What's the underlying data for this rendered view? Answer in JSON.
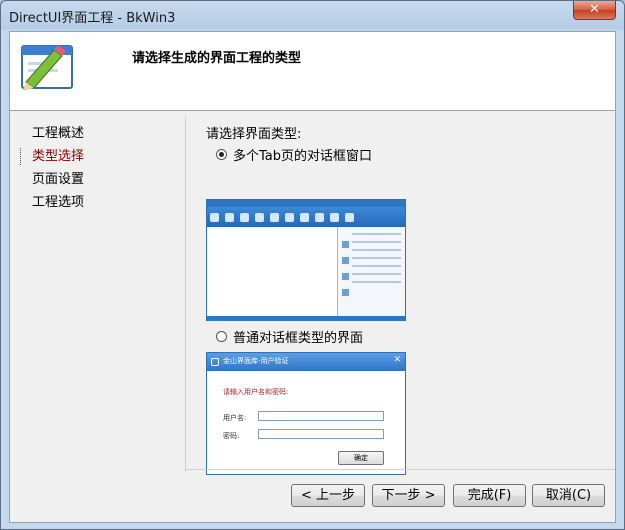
{
  "window": {
    "title": "DirectUI界面工程 - BkWin3",
    "close_label": "✕"
  },
  "header": {
    "title": "请选择生成的界面工程的类型"
  },
  "nav": {
    "items": [
      {
        "label": "工程概述"
      },
      {
        "label": "类型选择",
        "active": true
      },
      {
        "label": "页面设置"
      },
      {
        "label": "工程选项"
      }
    ]
  },
  "panel": {
    "label": "请选择界面类型:",
    "options": [
      {
        "label": "多个Tab页的对话框窗口",
        "checked": true
      },
      {
        "label": "普通对话框类型的界面",
        "checked": false
      }
    ],
    "preview2": {
      "caption": "金山界面库-用户验证",
      "prompt": "请输入用户名和密码:",
      "username_label": "用户名:",
      "password_label": "密码:",
      "confirm_label": "确定"
    }
  },
  "buttons": {
    "back": "< 上一步",
    "next": "下一步 >",
    "finish": "完成(F)",
    "cancel": "取消(C)"
  },
  "colors": {
    "accent": "#2d77c5",
    "active_nav": "#8b0000"
  }
}
